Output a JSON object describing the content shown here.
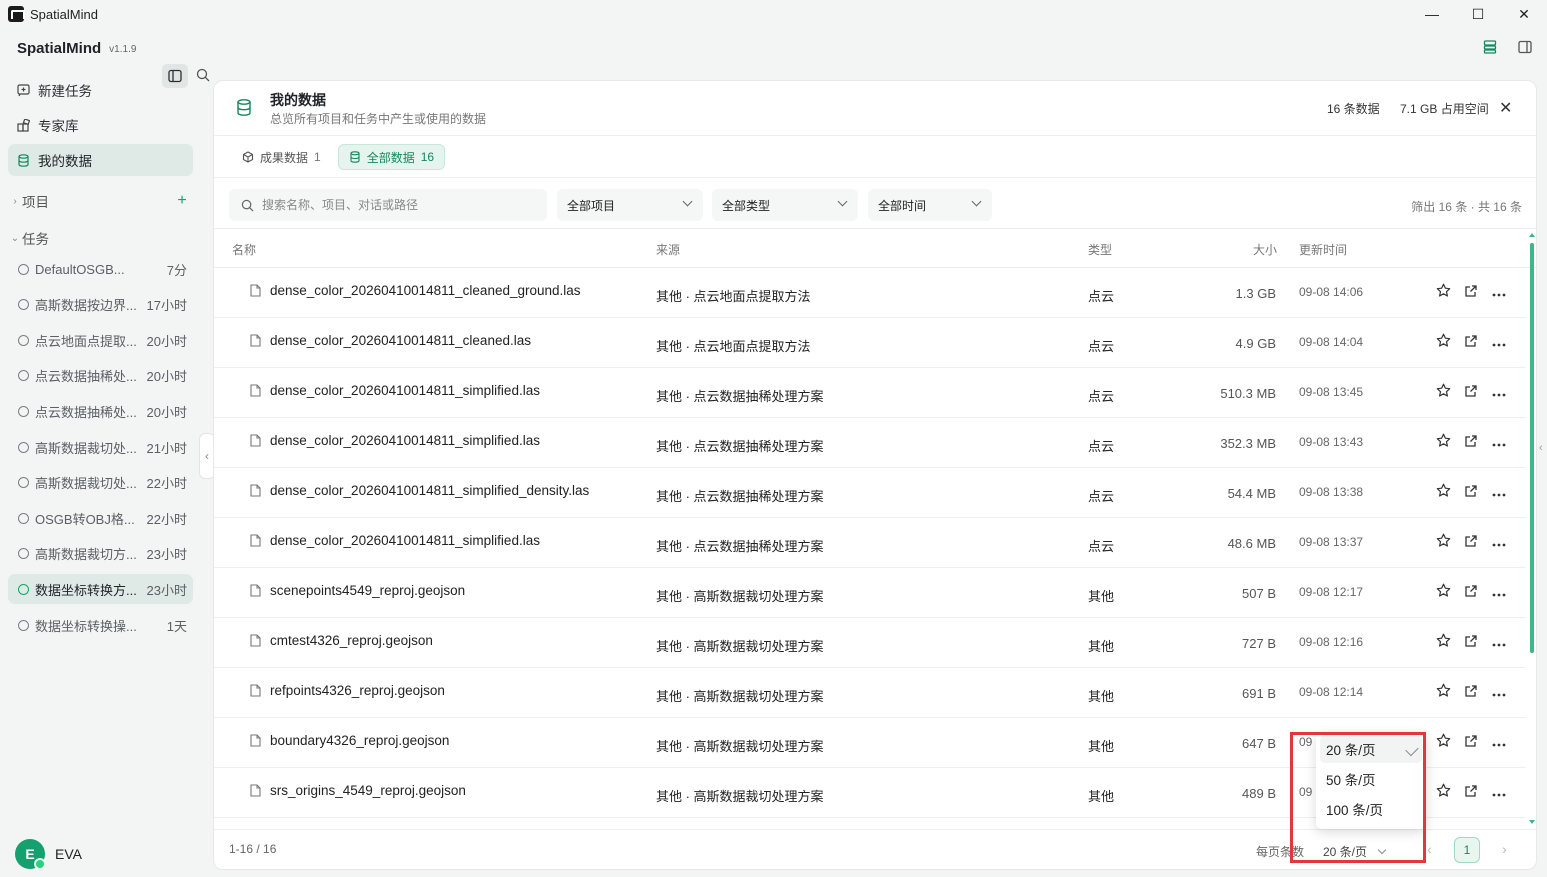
{
  "window": {
    "title": "SpatialMind",
    "controls": [
      "—",
      "☐",
      "✕"
    ]
  },
  "sidebar": {
    "brand": "SpatialMind",
    "version": "v1.1.9",
    "nav": [
      {
        "label": "新建任务",
        "icon": "new-task-icon"
      },
      {
        "label": "专家库",
        "icon": "expert-library-icon"
      },
      {
        "label": "我的数据",
        "icon": "database-icon",
        "active": true
      }
    ],
    "projects_label": "项目",
    "tasks_label": "任务",
    "tasks": [
      {
        "name": "DefaultOSGB...",
        "time": "7分"
      },
      {
        "name": "高斯数据按边界...",
        "time": "17小时"
      },
      {
        "name": "点云地面点提取...",
        "time": "20小时"
      },
      {
        "name": "点云数据抽稀处...",
        "time": "20小时"
      },
      {
        "name": "点云数据抽稀处...",
        "time": "20小时"
      },
      {
        "name": "高斯数据裁切处...",
        "time": "21小时"
      },
      {
        "name": "高斯数据裁切处...",
        "time": "22小时"
      },
      {
        "name": "OSGB转OBJ格...",
        "time": "22小时"
      },
      {
        "name": "高斯数据裁切方...",
        "time": "23小时"
      },
      {
        "name": "数据坐标转换方...",
        "time": "23小时",
        "active": true
      },
      {
        "name": "数据坐标转换操...",
        "time": "1天"
      }
    ],
    "user": {
      "initial": "E",
      "name": "EVA"
    }
  },
  "panel": {
    "title": "我的数据",
    "subtitle": "总览所有项目和任务中产生或使用的数据",
    "count_stat": "16 条数据",
    "space_stat": "7.1 GB 占用空间",
    "tabs": [
      {
        "label": "成果数据",
        "count": "1"
      },
      {
        "label": "全部数据",
        "count": "16",
        "active": true
      }
    ],
    "search_placeholder": "搜索名称、项目、对话或路径",
    "filters": {
      "project": "全部项目",
      "type": "全部类型",
      "time": "全部时间"
    },
    "filter_count": "筛出 16 条 · 共 16 条",
    "columns": {
      "name": "名称",
      "source": "来源",
      "type": "类型",
      "size": "大小",
      "updated": "更新时间"
    },
    "rows": [
      {
        "name": "dense_color_20260410014811_cleaned_ground.las",
        "source": "其他 · 点云地面点提取方法",
        "type": "点云",
        "size": "1.3 GB",
        "time": "09-08 14:06"
      },
      {
        "name": "dense_color_20260410014811_cleaned.las",
        "source": "其他 · 点云地面点提取方法",
        "type": "点云",
        "size": "4.9 GB",
        "time": "09-08 14:04"
      },
      {
        "name": "dense_color_20260410014811_simplified.las",
        "source": "其他 · 点云数据抽稀处理方案",
        "type": "点云",
        "size": "510.3 MB",
        "time": "09-08 13:45"
      },
      {
        "name": "dense_color_20260410014811_simplified.las",
        "source": "其他 · 点云数据抽稀处理方案",
        "type": "点云",
        "size": "352.3 MB",
        "time": "09-08 13:43"
      },
      {
        "name": "dense_color_20260410014811_simplified_density.las",
        "source": "其他 · 点云数据抽稀处理方案",
        "type": "点云",
        "size": "54.4 MB",
        "time": "09-08 13:38"
      },
      {
        "name": "dense_color_20260410014811_simplified.las",
        "source": "其他 · 点云数据抽稀处理方案",
        "type": "点云",
        "size": "48.6 MB",
        "time": "09-08 13:37"
      },
      {
        "name": "scenepoints4549_reproj.geojson",
        "source": "其他 · 高斯数据裁切处理方案",
        "type": "其他",
        "size": "507 B",
        "time": "09-08 12:17"
      },
      {
        "name": "cmtest4326_reproj.geojson",
        "source": "其他 · 高斯数据裁切处理方案",
        "type": "其他",
        "size": "727 B",
        "time": "09-08 12:16"
      },
      {
        "name": "refpoints4326_reproj.geojson",
        "source": "其他 · 高斯数据裁切处理方案",
        "type": "其他",
        "size": "691 B",
        "time": "09-08 12:14"
      },
      {
        "name": "boundary4326_reproj.geojson",
        "source": "其他 · 高斯数据裁切处理方案",
        "type": "其他",
        "size": "647 B",
        "time": "09"
      },
      {
        "name": "srs_origins_4549_reproj.geojson",
        "source": "其他 · 高斯数据裁切处理方案",
        "type": "其他",
        "size": "489 B",
        "time": "09"
      }
    ],
    "footer": {
      "range": "1-16 / 16",
      "per_page_label": "每页条数",
      "per_page_value": "20 条/页",
      "page": "1",
      "prev": "‹",
      "next": "›"
    },
    "page_size_options": [
      "20 条/页",
      "50 条/页",
      "100 条/页"
    ]
  },
  "colors": {
    "accent": "#15865d",
    "highlight": "#e0383e"
  }
}
